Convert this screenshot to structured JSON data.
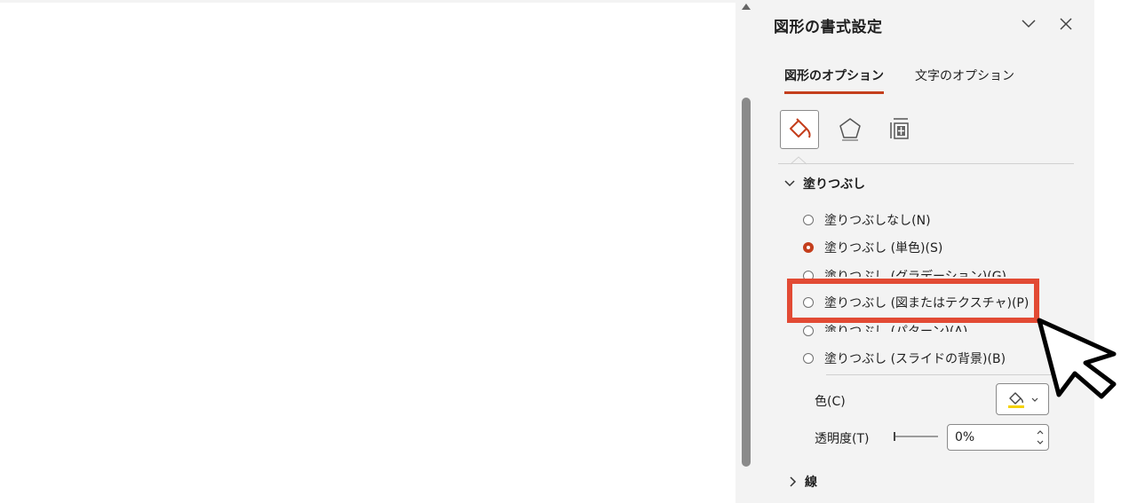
{
  "pane": {
    "title": "図形の書式設定",
    "tabs": [
      {
        "label": "図形のオプション",
        "active": true
      },
      {
        "label": "文字のオプション",
        "active": false
      }
    ],
    "icon_tabs": [
      "fill-line-icon",
      "effects-pentagon-icon",
      "size-properties-icon"
    ],
    "fill_section": {
      "label": "塗りつぶし",
      "options": [
        {
          "label": "塗りつぶしなし(N)",
          "selected": false
        },
        {
          "label": "塗りつぶし (単色)(S)",
          "selected": true
        },
        {
          "label": "塗りつぶし (グラデーション)(G)",
          "selected": false
        },
        {
          "label": "塗りつぶし (図またはテクスチャ)(P)",
          "selected": false
        },
        {
          "label": "塗りつぶし (パターン)(A)",
          "selected": false
        },
        {
          "label": "塗りつぶし (スライドの背景)(B)",
          "selected": false
        }
      ],
      "color_label": "色(C)",
      "transparency_label": "透明度(T)",
      "transparency_value": "0%"
    },
    "line_section": {
      "label": "線"
    }
  },
  "colors": {
    "accent": "#c43e1c",
    "highlight_box": "#e24a34",
    "fill_swatch": "#f5d200",
    "pane_bg": "#f3f3f3"
  }
}
